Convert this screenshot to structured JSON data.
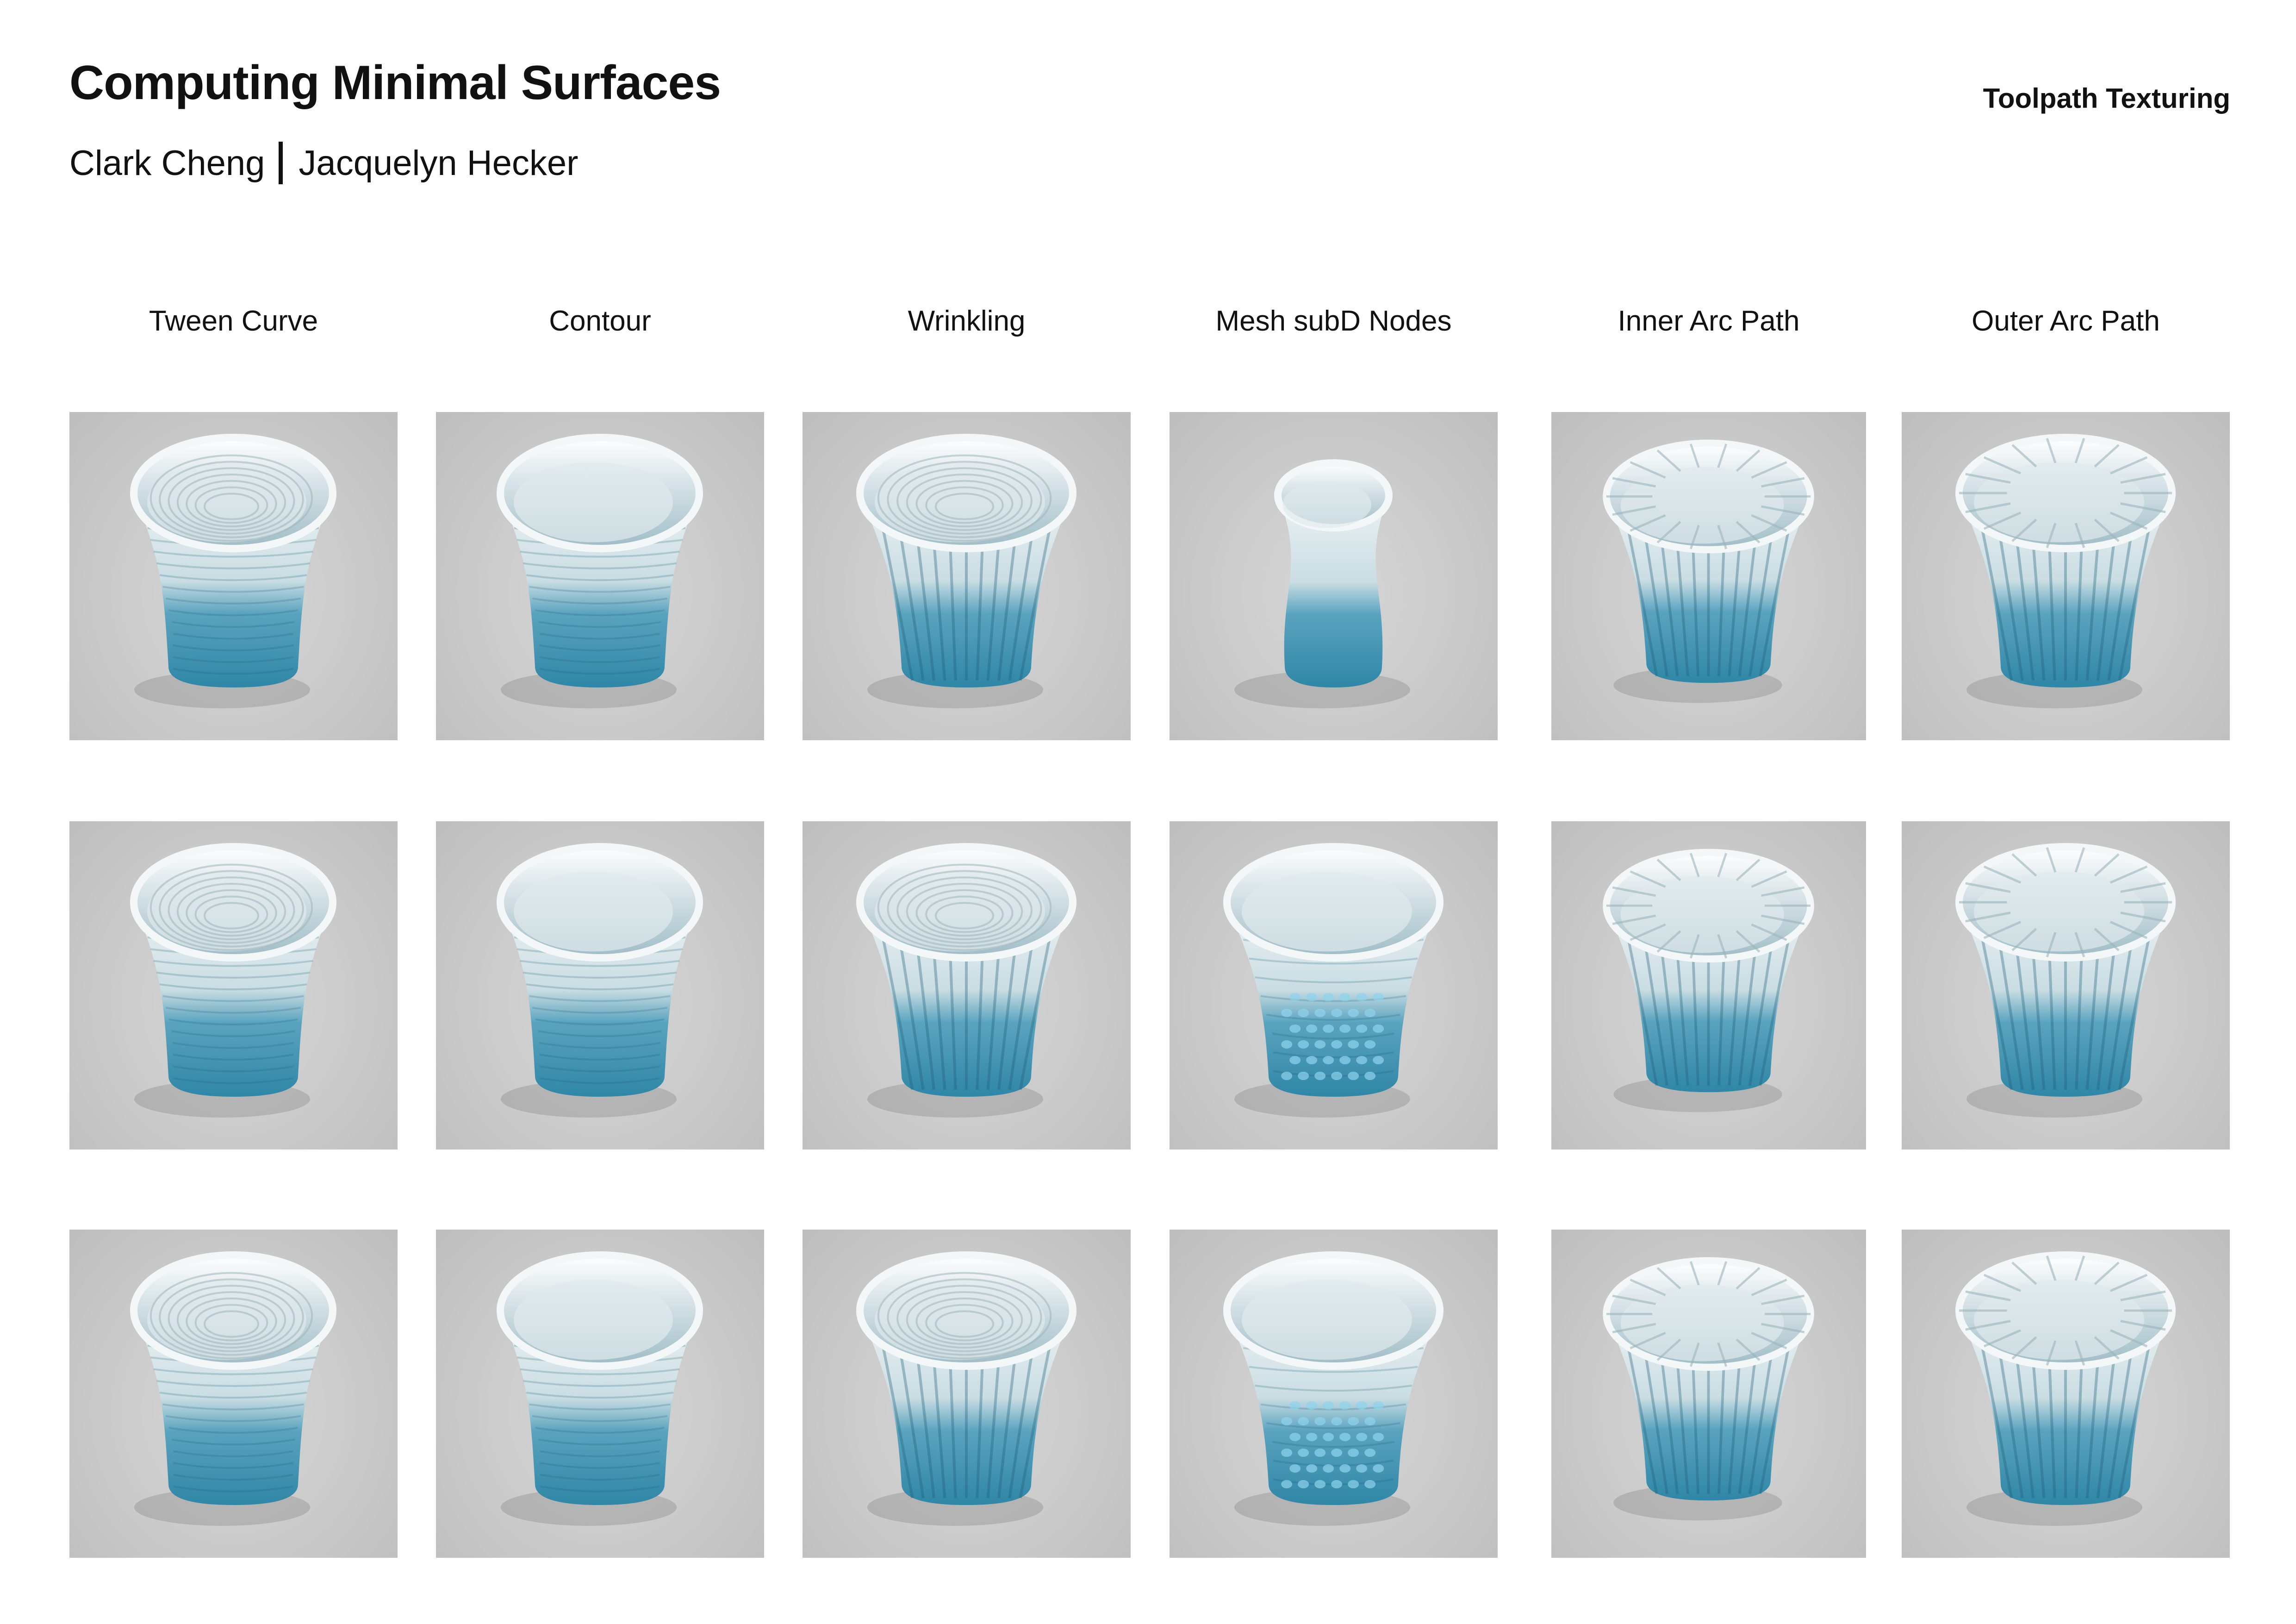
{
  "header": {
    "title": "Computing Minimal Surfaces",
    "author_1": "Clark Cheng",
    "author_2": "Jacquelyn Hecker",
    "section": "Toolpath Texturing"
  },
  "columns": [
    "Tween Curve",
    "Contour",
    "Wrinkling",
    "Mesh subD Nodes",
    "Inner Arc Path",
    "Outer Arc Path"
  ],
  "colors": {
    "glaze_top": "#eef3f4",
    "glaze_bottom": "#2f86a6",
    "backdrop": "#c9c9c9"
  }
}
